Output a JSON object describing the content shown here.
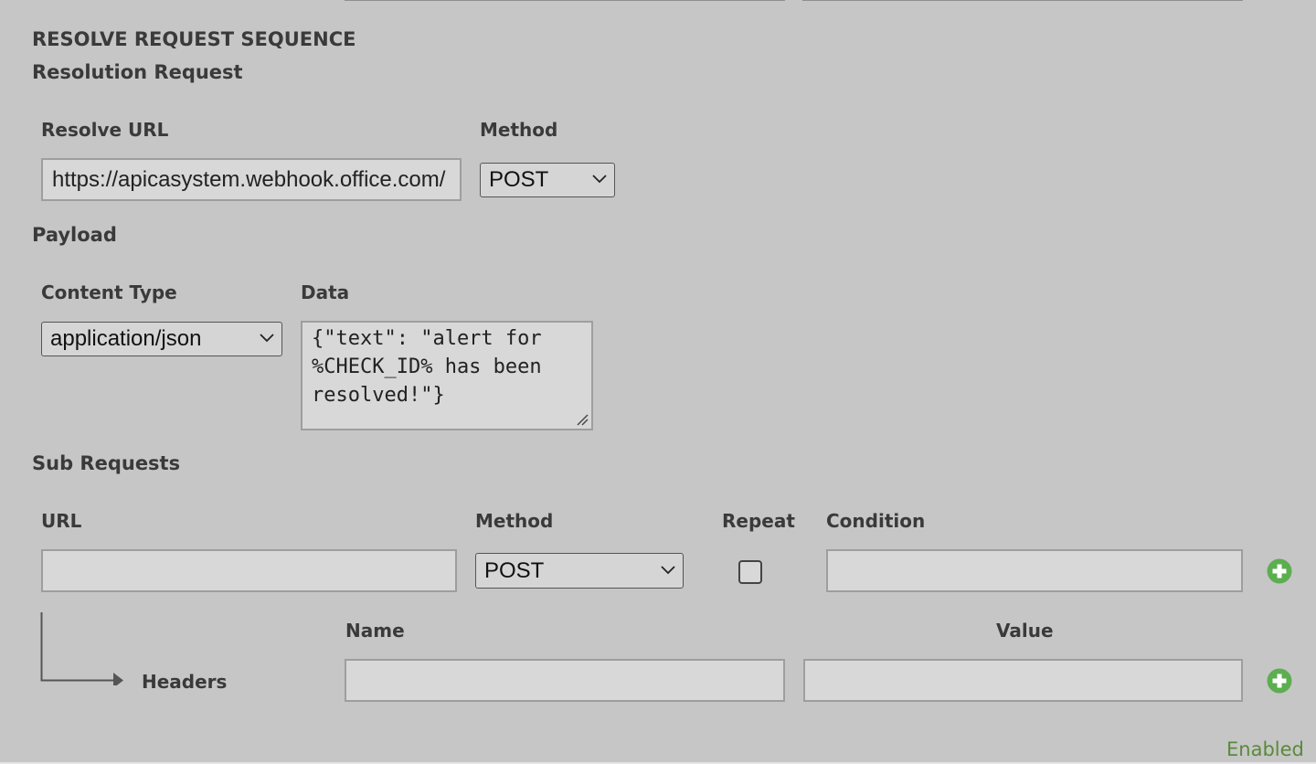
{
  "section": {
    "title": "RESOLVE REQUEST SEQUENCE",
    "subtitle": "Resolution Request"
  },
  "resolve": {
    "url_label": "Resolve URL",
    "url_value": "https://apicasystem.webhook.office.com/",
    "method_label": "Method",
    "method_value": "POST"
  },
  "payload": {
    "title": "Payload",
    "content_type_label": "Content Type",
    "content_type_value": "application/json",
    "data_label": "Data",
    "data_value": "{\"text\": \"alert for %CHECK_ID% has been resolved!\"}"
  },
  "sub_requests": {
    "title": "Sub Requests",
    "url_label": "URL",
    "url_value": "",
    "method_label": "Method",
    "method_value": "POST",
    "repeat_label": "Repeat",
    "repeat_checked": false,
    "condition_label": "Condition",
    "condition_value": ""
  },
  "headers": {
    "label": "Headers",
    "name_label": "Name",
    "name_value": "",
    "value_label": "Value",
    "value_value": ""
  },
  "status": {
    "enabled_label": "Enabled"
  },
  "colors": {
    "background": "#c6c6c6",
    "add_icon": "#5cae50",
    "enabled_text": "#5a8a3a"
  }
}
